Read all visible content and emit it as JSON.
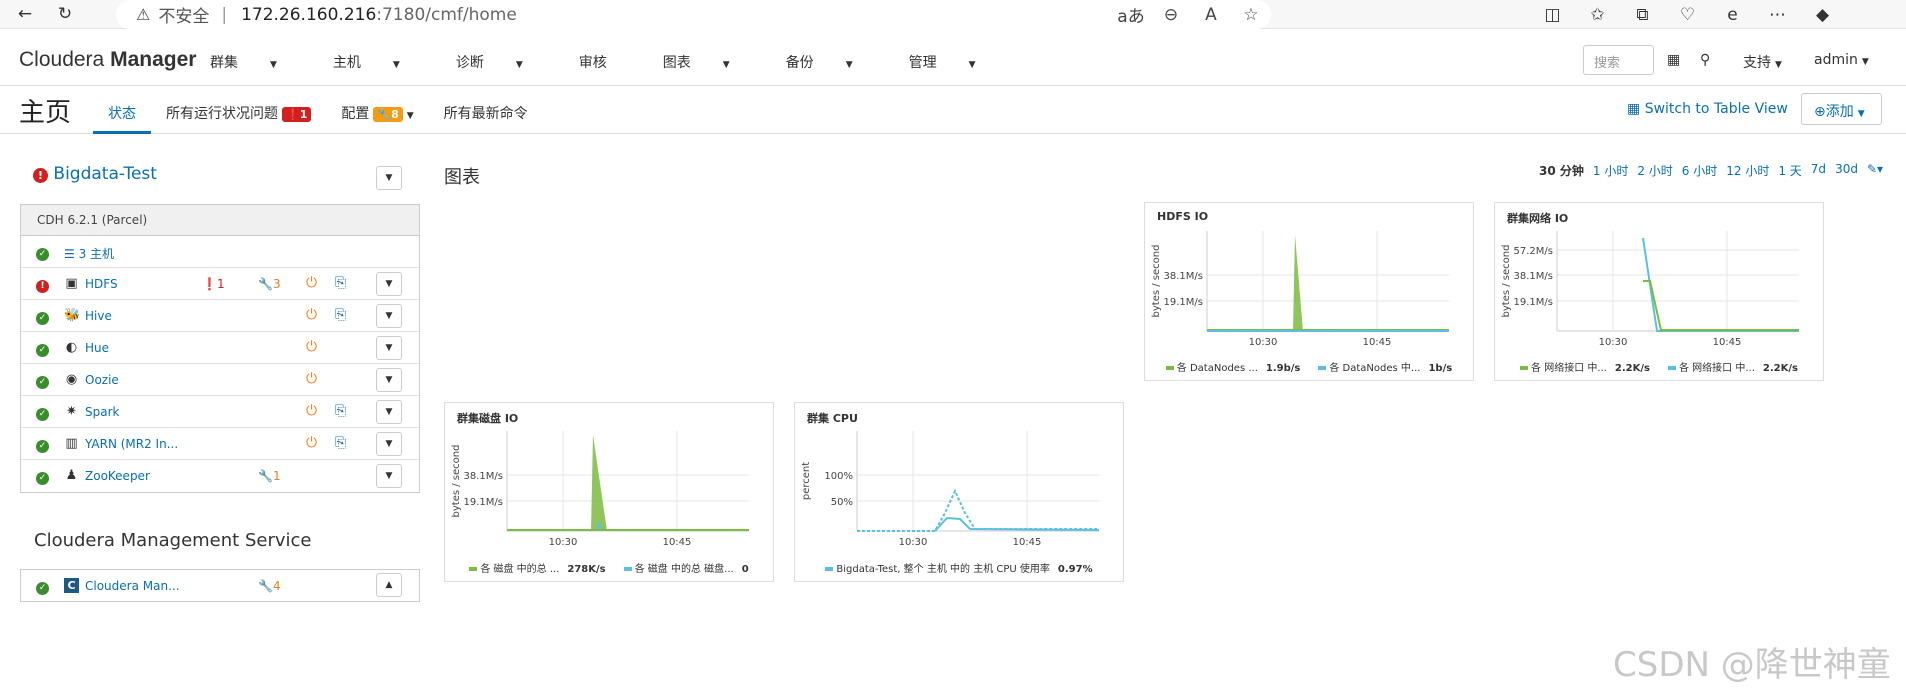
{
  "browser": {
    "security_warning": "不安全",
    "url_host": "172.26.160.216",
    "url_path": ":7180/cmf/home"
  },
  "navbar": {
    "brand_light": "Cloudera",
    "brand_bold": "Manager",
    "menu": [
      "群集",
      "主机",
      "诊断",
      "审核",
      "图表",
      "备份",
      "管理"
    ],
    "search_placeholder": "搜索",
    "support_label": "支持",
    "user_label": "admin"
  },
  "page": {
    "title": "主页",
    "tabs": {
      "status": "状态",
      "issues": "所有运行状况问题",
      "issues_count": "1",
      "config": "配置",
      "config_count": "8",
      "commands": "所有最新命令"
    },
    "switch_view": "Switch to Table View",
    "add_button": "添加"
  },
  "cluster": {
    "name": "Bigdata-Test",
    "version": "CDH 6.2.1 (Parcel)",
    "hosts_label": "3 主机",
    "services": [
      {
        "name": "HDFS",
        "status": "error",
        "issues": "1",
        "config": "3",
        "icon": "hdfs-icon"
      },
      {
        "name": "Hive",
        "status": "ok",
        "issues": "",
        "config": "",
        "icon": "hive-icon"
      },
      {
        "name": "Hue",
        "status": "ok",
        "issues": "",
        "config": "",
        "icon": "hue-icon"
      },
      {
        "name": "Oozie",
        "status": "ok",
        "issues": "",
        "config": "",
        "icon": "oozie-icon"
      },
      {
        "name": "Spark",
        "status": "ok",
        "issues": "",
        "config": "",
        "icon": "spark-icon"
      },
      {
        "name": "YARN (MR2 In...",
        "status": "ok",
        "issues": "",
        "config": "",
        "icon": "yarn-icon"
      },
      {
        "name": "ZooKeeper",
        "status": "ok",
        "issues": "",
        "config": "1",
        "icon": "zookeeper-icon"
      }
    ]
  },
  "management": {
    "title": "Cloudera Management Service",
    "service_name": "Cloudera Man...",
    "config": "4"
  },
  "charts_section": {
    "title": "图表",
    "time_ranges": [
      "30 分钟",
      "1 小时",
      "2 小时",
      "6 小时",
      "12 小时",
      "1 天",
      "7d",
      "30d"
    ],
    "selected_range": "30 分钟"
  },
  "colors": {
    "accent": "#0a6fb1",
    "error": "#d21f1f",
    "ok": "#3c8d2f",
    "warning": "#f39c12",
    "series_green": "#7dbb42",
    "series_blue": "#5bc0de"
  },
  "chart_data": [
    {
      "type": "area",
      "title": "HDFS IO",
      "ylabel": "bytes / second",
      "y_ticks": [
        "19.1M/s",
        "38.1M/s"
      ],
      "x_ticks": [
        "10:30",
        "10:45"
      ],
      "series": [
        {
          "name": "各 DataNodes ...",
          "value_label": "1.9b/s",
          "color": "#7dbb42"
        },
        {
          "name": "各 DataNodes 中...",
          "value_label": "1b/s",
          "color": "#5bc0de"
        }
      ]
    },
    {
      "type": "line",
      "title": "群集网络 IO",
      "ylabel": "bytes / second",
      "y_ticks": [
        "19.1M/s",
        "38.1M/s",
        "57.2M/s"
      ],
      "x_ticks": [
        "10:30",
        "10:45"
      ],
      "series": [
        {
          "name": "各 网络接口 中...",
          "value_label": "2.2K/s",
          "color": "#7dbb42"
        },
        {
          "name": "各 网络接口 中...",
          "value_label": "2.2K/s",
          "color": "#5bc0de"
        }
      ]
    },
    {
      "type": "area",
      "title": "群集磁盘 IO",
      "ylabel": "bytes / second",
      "y_ticks": [
        "19.1M/s",
        "38.1M/s"
      ],
      "x_ticks": [
        "10:30",
        "10:45"
      ],
      "series": [
        {
          "name": "各 磁盘 中的总 ...",
          "value_label": "278K/s",
          "color": "#7dbb42"
        },
        {
          "name": "各 磁盘 中的总 磁盘...",
          "value_label": "0",
          "color": "#5bc0de"
        }
      ]
    },
    {
      "type": "line",
      "title": "群集 CPU",
      "ylabel": "percent",
      "y_ticks": [
        "50%",
        "100%"
      ],
      "x_ticks": [
        "10:30",
        "10:45"
      ],
      "series": [
        {
          "name": "Bigdata-Test, 整个 主机 中的 主机 CPU 使用率",
          "value_label": "0.97%",
          "color": "#5bc0de"
        }
      ]
    }
  ],
  "watermark": "CSDN @降世神童"
}
